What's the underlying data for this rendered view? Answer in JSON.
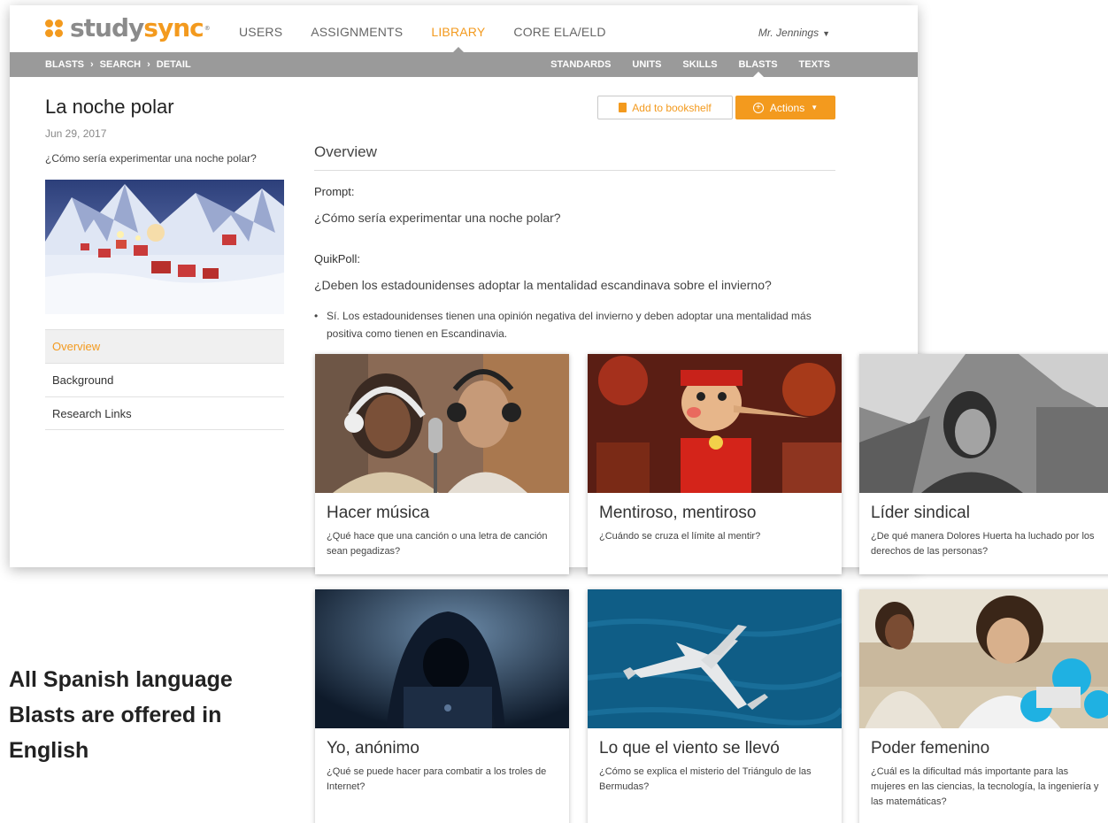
{
  "brand": {
    "logo_part1": "study",
    "logo_part2": "sync",
    "trademark": "®"
  },
  "nav": {
    "items": [
      {
        "label": "USERS"
      },
      {
        "label": "ASSIGNMENTS"
      },
      {
        "label": "LIBRARY",
        "active": true
      },
      {
        "label": "CORE ELA/ELD"
      }
    ],
    "user": "Mr. Jennings"
  },
  "breadcrumb": [
    "BLASTS",
    "SEARCH",
    "DETAIL"
  ],
  "subnav": {
    "items": [
      {
        "label": "STANDARDS"
      },
      {
        "label": "UNITS"
      },
      {
        "label": "SKILLS"
      },
      {
        "label": "BLASTS",
        "active": true
      },
      {
        "label": "TEXTS"
      }
    ]
  },
  "blast": {
    "title": "La noche polar",
    "date": "Jun 29, 2017",
    "question": "¿Cómo sería experimentar una noche polar?"
  },
  "sidenav": {
    "items": [
      {
        "label": "Overview",
        "active": true
      },
      {
        "label": "Background"
      },
      {
        "label": "Research Links"
      }
    ]
  },
  "buttons": {
    "bookshelf": "Add to bookshelf",
    "actions": "Actions"
  },
  "overview": {
    "heading": "Overview",
    "prompt_label": "Prompt:",
    "prompt_text": "¿Cómo sería experimentar una noche polar?",
    "poll_label": "QuikPoll:",
    "poll_question": "¿Deben los estadounidenses adoptar la mentalidad escandinava sobre el invierno?",
    "poll_option": "Sí. Los estadounidenses tienen una opinión negativa del invierno y deben adoptar una mentalidad más positiva como tienen en Escandinavia."
  },
  "cards": [
    {
      "title": "Hacer música",
      "desc": "¿Qué hace que una canción o una letra de canción sean pegadizas?"
    },
    {
      "title": "Mentiroso, mentiroso",
      "desc": "¿Cuándo se cruza el límite al mentir?"
    },
    {
      "title": "Líder sindical",
      "desc": "¿De qué manera Dolores Huerta ha luchado por los derechos de las personas?"
    },
    {
      "title": "Yo, anónimo",
      "desc": "¿Qué se puede hacer para combatir a los troles de Internet?"
    },
    {
      "title": "Lo que el viento se llevó",
      "desc": "¿Cómo se explica el misterio del Triángulo de las Bermudas?"
    },
    {
      "title": "Poder femenino",
      "desc": "¿Cuál es la dificultad más importante para las mujeres en las ciencias, la tecnología, la ingeniería y las matemáticas?"
    }
  ],
  "tagline": "All Spanish language Blasts are offered in English",
  "colors": {
    "accent": "#f39a1e",
    "subbar": "#9a9a9a",
    "logo_gray": "#8b8b8b"
  }
}
